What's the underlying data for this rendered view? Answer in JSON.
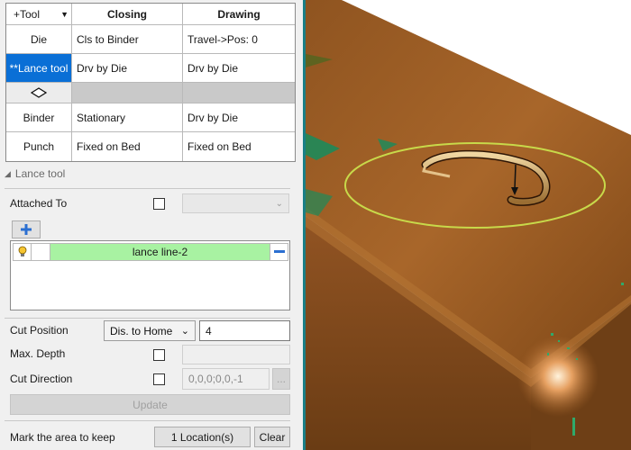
{
  "grid": {
    "header": {
      "tool": "+Tool",
      "closing": "Closing",
      "drawing": "Drawing"
    },
    "rows": [
      {
        "tool": "Die",
        "closing": "Cls to Binder",
        "drawing": "Travel->Pos: 0"
      },
      {
        "tool": "**Lance tool",
        "closing": "Drv by Die",
        "drawing": "Drv by Die"
      },
      {
        "tool": "",
        "closing": "",
        "drawing": ""
      },
      {
        "tool": "Binder",
        "closing": "Stationary",
        "drawing": "Drv by Die"
      },
      {
        "tool": "Punch",
        "closing": "Fixed on Bed",
        "drawing": "Fixed on Bed"
      }
    ]
  },
  "section": {
    "title": "Lance tool"
  },
  "attached_to": {
    "label": "Attached To",
    "value": ""
  },
  "lines": {
    "items": [
      {
        "name": "lance line-2"
      }
    ]
  },
  "cut_position": {
    "label": "Cut Position",
    "mode": "Dis. to Home",
    "value": "4"
  },
  "max_depth": {
    "label": "Max. Depth",
    "value": ""
  },
  "cut_direction": {
    "label": "Cut Direction",
    "value": "0,0,0;0,0,-1",
    "browse_label": "..."
  },
  "update_label": "Update",
  "mark_area": {
    "label": "Mark the area to keep",
    "location_button": "1 Location(s)",
    "clear_button": "Clear"
  },
  "colors": {
    "selected": "#0a6fd6",
    "list_highlight": "#a8f2a2",
    "part": "#9a5a23",
    "ring": "#c8d94a",
    "divider": "#1a7f86"
  }
}
